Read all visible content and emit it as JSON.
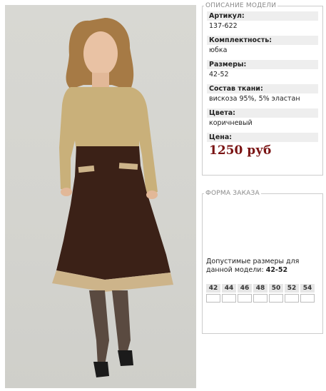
{
  "description": {
    "legend": "ОПИСАНИЕ МОДЕЛИ",
    "fields": [
      {
        "label": "Артикул:",
        "value": "137-622"
      },
      {
        "label": "Комплектность:",
        "value": "юбка"
      },
      {
        "label": "Размеры:",
        "value": "42-52"
      },
      {
        "label": "Состав ткани:",
        "value": "вискоза 95%, 5% эластан"
      },
      {
        "label": "Цвета:",
        "value": "коричневый"
      }
    ],
    "price_label": "Цена:",
    "price": "1250 руб",
    "price_color": "#7a1414"
  },
  "order": {
    "legend": "ФОРМА ЗАКАЗА",
    "sizes_note": "Допустимые размеры для данной модели:",
    "sizes_range": "42-52",
    "sizes": [
      "42",
      "44",
      "46",
      "48",
      "50",
      "52",
      "54"
    ]
  }
}
